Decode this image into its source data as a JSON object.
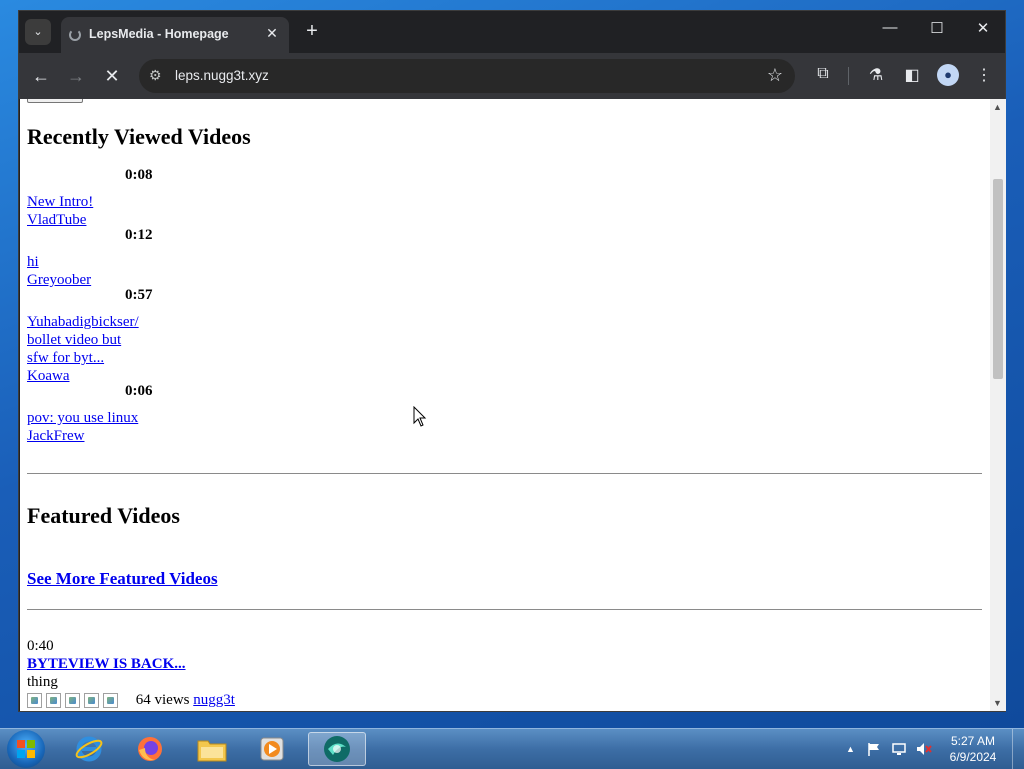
{
  "browser": {
    "tab_title": "LepsMedia - Homepage",
    "url": "leps.nugg3t.xyz",
    "tab_close": "✕",
    "new_tab": "+",
    "minimize": "—",
    "maximize": "☐",
    "close": "✕",
    "back": "←",
    "forward": "→",
    "stop": "✕",
    "tab_search": "⌄",
    "site_info": "⚙",
    "bookmark": "☆",
    "extensions": "⧉",
    "labs": "⚗",
    "side_panel": "◧",
    "profile": "●",
    "menu": "⋮"
  },
  "page": {
    "recent_heading": "Recently Viewed Videos",
    "recent_videos": [
      {
        "duration": "0:08",
        "title_lines": [
          "New Intro!"
        ],
        "author": "VladTube"
      },
      {
        "duration": "0:12",
        "title_lines": [
          "hi"
        ],
        "author": "Greyoober"
      },
      {
        "duration": "0:57",
        "title_lines": [
          "Yuhabadigbickser/",
          "bollet video but",
          "sfw for byt..."
        ],
        "author": "Koawa"
      },
      {
        "duration": "0:06",
        "title_lines": [
          "pov: you use linux"
        ],
        "author": "JackFrew"
      }
    ],
    "featured_heading": "Featured Videos",
    "see_more": "See More Featured Videos",
    "featured_video": {
      "duration": "0:40",
      "title": "BYTEVIEW IS BACK...",
      "description": "thing",
      "views": "64 views",
      "author": "nugg3t",
      "rating_stars": 5
    }
  },
  "taskbar": {
    "clock_time": "5:27 AM",
    "clock_date": "6/9/2024",
    "tray_arrow": "▲"
  },
  "colors": {
    "link": "#0000ee",
    "browser_frame": "#202124",
    "toolbar": "#35363a"
  }
}
